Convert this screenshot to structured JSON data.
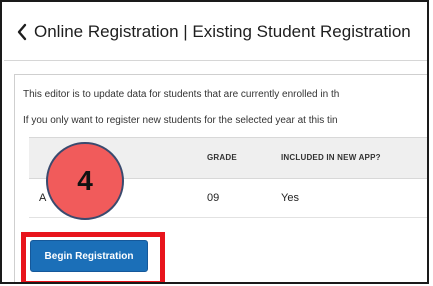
{
  "header": {
    "title": "Online Registration | Existing Student Registration"
  },
  "content": {
    "line1": "This editor is to update data for students that are currently enrolled in th",
    "line2": "If you only want to register new students for the selected year at this tin"
  },
  "table": {
    "headers": [
      "",
      "GRADE",
      "INCLUDED IN NEW APP?"
    ],
    "rows": [
      {
        "name": "A",
        "grade": "09",
        "included": "Yes"
      }
    ]
  },
  "actions": {
    "begin_label": "Begin Registration"
  },
  "annotation": {
    "step_number": "4",
    "highlight_color": "#e8141c",
    "badge_color": "#f15b5b"
  },
  "colors": {
    "primary_button": "#1b6fb8"
  },
  "icons": {
    "back": "chevron-left-icon"
  }
}
